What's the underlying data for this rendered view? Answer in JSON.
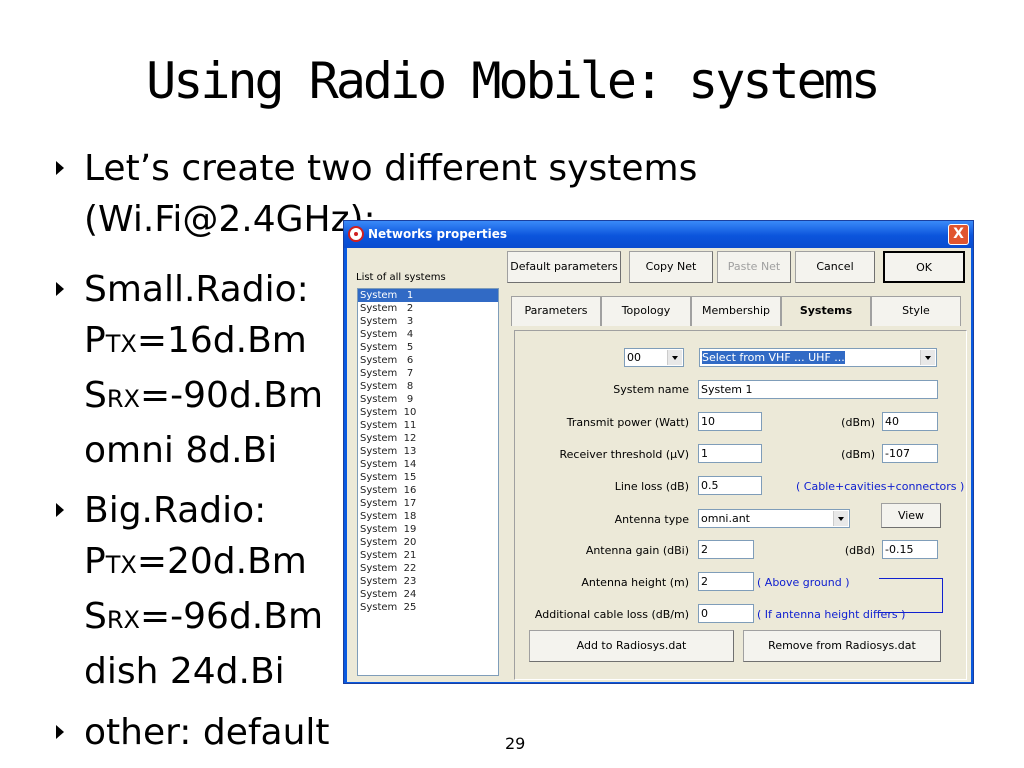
{
  "slide": {
    "title": "Using Radio Mobile: systems",
    "page_number": "29",
    "bullets": [
      {
        "lines": [
          "Let’s create two different systems",
          "(Wi.Fi@2.4GHz):"
        ]
      },
      {
        "lines": [
          "Small.Radio:"
        ],
        "ptx": "=16d.Bm",
        "srx": "=-90d.Bm",
        "ant": "omni 8d.Bi"
      },
      {
        "lines": [
          "Big.Radio:"
        ],
        "ptx": "=20d.Bm",
        "srx": "=-96d.Bm",
        "ant": "dish 24d.Bi"
      },
      {
        "lines": [
          "other: default"
        ]
      }
    ],
    "sub_p": "P",
    "sub_tx": "TX",
    "sub_s": "S",
    "sub_rx": "RX"
  },
  "dialog": {
    "title": "Networks properties",
    "close_label": "X",
    "list_label": "List of all systems",
    "systems": [
      "System   1",
      "System   2",
      "System   3",
      "System   4",
      "System   5",
      "System   6",
      "System   7",
      "System   8",
      "System   9",
      "System  10",
      "System  11",
      "System  12",
      "System  13",
      "System  14",
      "System  15",
      "System  16",
      "System  17",
      "System  18",
      "System  19",
      "System  20",
      "System  21",
      "System  22",
      "System  23",
      "System  24",
      "System  25"
    ],
    "selected_index": 0,
    "buttons": {
      "default_params": "Default parameters",
      "copy_net": "Copy Net",
      "paste_net": "Paste Net",
      "cancel": "Cancel",
      "ok": "OK",
      "view": "View",
      "add": "Add to Radiosys.dat",
      "remove": "Remove from Radiosys.dat"
    },
    "tabs": [
      "Parameters",
      "Topology",
      "Membership",
      "Systems",
      "Style"
    ],
    "active_tab": "Systems",
    "form": {
      "index_combo": "00",
      "preset_combo": "Select from VHF ... UHF ...",
      "system_name_label": "System name",
      "system_name": "System   1",
      "tx_power_label": "Transmit power (Watt)",
      "tx_power_watt": "10",
      "dbm_label": "(dBm)",
      "tx_power_dbm": "40",
      "rx_threshold_label": "Receiver threshold (µV)",
      "rx_threshold_uv": "1",
      "rx_threshold_dbm": "-107",
      "line_loss_label": "Line loss (dB)",
      "line_loss": "0.5",
      "line_loss_note": "( Cable+cavities+connectors )",
      "antenna_type_label": "Antenna type",
      "antenna_type": "omni.ant",
      "antenna_gain_label": "Antenna gain (dBi)",
      "antenna_gain": "2",
      "dbd_label": "(dBd)",
      "antenna_gain_dbd": "-0.15",
      "antenna_height_label": "Antenna height (m)",
      "antenna_height": "2",
      "antenna_height_note": "( Above ground )",
      "cable_loss_label": "Additional cable loss (dB/m)",
      "cable_loss": "0",
      "cable_loss_note": "( If antenna height differs )"
    }
  }
}
